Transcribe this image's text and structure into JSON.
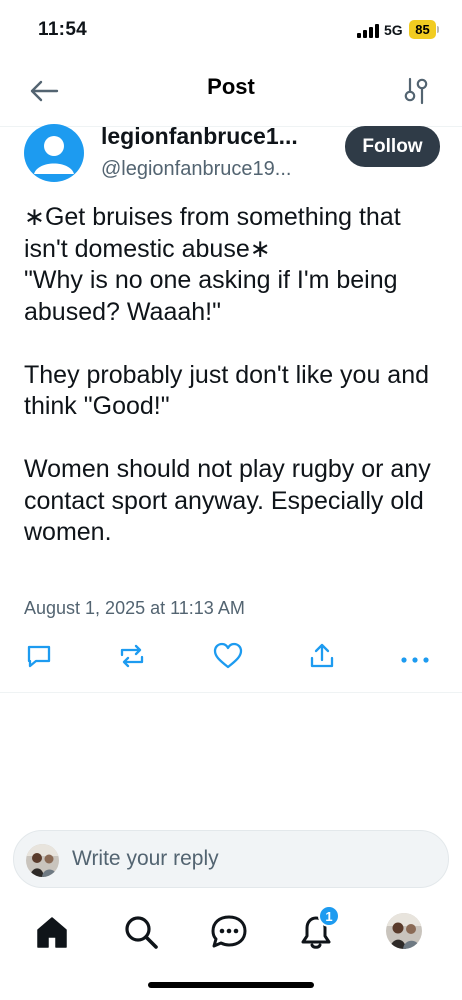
{
  "status_bar": {
    "time": "11:54",
    "network": "5G",
    "battery": "85"
  },
  "header": {
    "title": "Post",
    "back_icon": "arrow-left-icon",
    "settings_icon": "sliders-icon"
  },
  "author": {
    "display_name": "legionfanbruce1...",
    "handle": "@legionfanbruce19...",
    "follow_label": "Follow"
  },
  "post": {
    "text": "∗Get bruises from something that isn't domestic abuse∗\n\"Why is no one asking if I'm being abused? Waaah!\"\n\nThey probably just don't like you and think \"Good!\"\n\nWomen should not play rugby or any contact sport anyway. Especially old women.",
    "timestamp": "August 1, 2025 at 11:13 AM"
  },
  "actions": {
    "icons": [
      "reply-icon",
      "repost-icon",
      "like-icon",
      "share-icon",
      "more-icon"
    ]
  },
  "reply": {
    "placeholder": "Write your reply"
  },
  "tabbar": {
    "icons": [
      "home-icon",
      "search-icon",
      "chat-icon",
      "bell-icon",
      "profile-avatar"
    ],
    "notification_count": "1"
  },
  "colors": {
    "accent": "#1d9bf0",
    "follow_bg": "#2f3b47",
    "secondary_text": "#536471"
  }
}
